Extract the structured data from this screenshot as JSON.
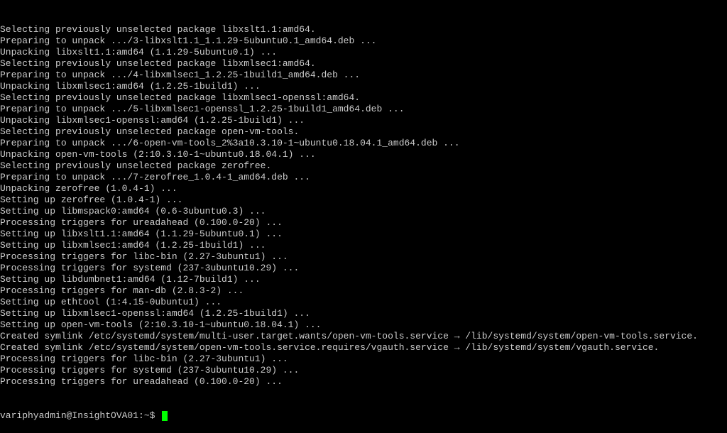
{
  "terminal": {
    "lines": [
      "Selecting previously unselected package libxslt1.1:amd64.",
      "Preparing to unpack .../3-libxslt1.1_1.1.29-5ubuntu0.1_amd64.deb ...",
      "Unpacking libxslt1.1:amd64 (1.1.29-5ubuntu0.1) ...",
      "Selecting previously unselected package libxmlsec1:amd64.",
      "Preparing to unpack .../4-libxmlsec1_1.2.25-1build1_amd64.deb ...",
      "Unpacking libxmlsec1:amd64 (1.2.25-1build1) ...",
      "Selecting previously unselected package libxmlsec1-openssl:amd64.",
      "Preparing to unpack .../5-libxmlsec1-openssl_1.2.25-1build1_amd64.deb ...",
      "Unpacking libxmlsec1-openssl:amd64 (1.2.25-1build1) ...",
      "Selecting previously unselected package open-vm-tools.",
      "Preparing to unpack .../6-open-vm-tools_2%3a10.3.10-1~ubuntu0.18.04.1_amd64.deb ...",
      "Unpacking open-vm-tools (2:10.3.10-1~ubuntu0.18.04.1) ...",
      "Selecting previously unselected package zerofree.",
      "Preparing to unpack .../7-zerofree_1.0.4-1_amd64.deb ...",
      "Unpacking zerofree (1.0.4-1) ...",
      "Setting up zerofree (1.0.4-1) ...",
      "Setting up libmspack0:amd64 (0.6-3ubuntu0.3) ...",
      "Processing triggers for ureadahead (0.100.0-20) ...",
      "Setting up libxslt1.1:amd64 (1.1.29-5ubuntu0.1) ...",
      "Setting up libxmlsec1:amd64 (1.2.25-1build1) ...",
      "Processing triggers for libc-bin (2.27-3ubuntu1) ...",
      "Processing triggers for systemd (237-3ubuntu10.29) ...",
      "Setting up libdumbnet1:amd64 (1.12-7build1) ...",
      "Processing triggers for man-db (2.8.3-2) ...",
      "Setting up ethtool (1:4.15-0ubuntu1) ...",
      "Setting up libxmlsec1-openssl:amd64 (1.2.25-1build1) ...",
      "Setting up open-vm-tools (2:10.3.10-1~ubuntu0.18.04.1) ...",
      "Created symlink /etc/systemd/system/multi-user.target.wants/open-vm-tools.service → /lib/systemd/system/open-vm-tools.service.",
      "Created symlink /etc/systemd/system/open-vm-tools.service.requires/vgauth.service → /lib/systemd/system/vgauth.service.",
      "Processing triggers for libc-bin (2.27-3ubuntu1) ...",
      "Processing triggers for systemd (237-3ubuntu10.29) ...",
      "Processing triggers for ureadahead (0.100.0-20) ..."
    ],
    "prompt": "variphyadmin@InsightOVA01:~$ "
  }
}
